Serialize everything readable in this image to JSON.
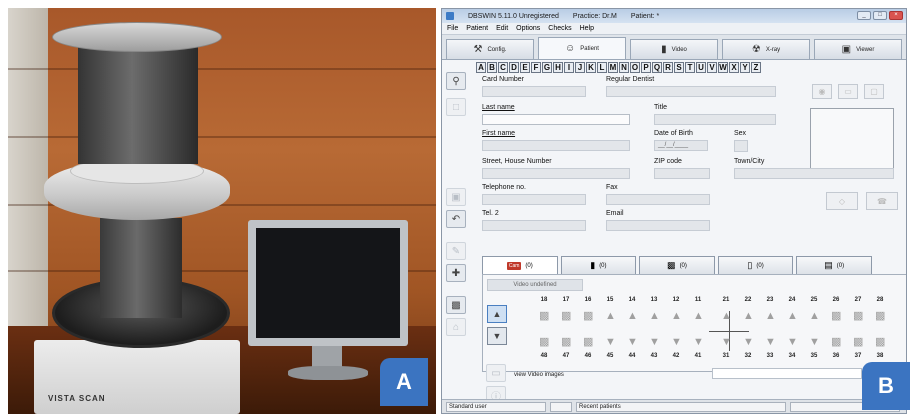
{
  "panel_a": {
    "scanner_brand": "VISTA SCAN",
    "badge": "A"
  },
  "panel_b": {
    "badge": "B",
    "window": {
      "app_title": "DBSWIN 5.11.0 Unregistered",
      "practice": "Practice: Dr.M",
      "patient": "Patient: *",
      "controls": [
        "_",
        "□",
        "×"
      ]
    },
    "menu": [
      "File",
      "Patient",
      "Edit",
      "Options",
      "Checks",
      "Help"
    ],
    "tabs": [
      {
        "label": "Config.",
        "icon": "wrench-icon",
        "glyph": "⚒"
      },
      {
        "label": "Patient",
        "icon": "patient-icon",
        "glyph": "☺"
      },
      {
        "label": "Video",
        "icon": "video-camera-icon",
        "glyph": "▮"
      },
      {
        "label": "X-ray",
        "icon": "radiation-icon",
        "glyph": "☢"
      },
      {
        "label": "Viewer",
        "icon": "viewer-icon",
        "glyph": "▣"
      }
    ],
    "alphabet": [
      "A",
      "B",
      "C",
      "D",
      "E",
      "F",
      "G",
      "H",
      "I",
      "J",
      "K",
      "L",
      "M",
      "N",
      "O",
      "P",
      "Q",
      "R",
      "S",
      "T",
      "U",
      "V",
      "W",
      "X",
      "Y",
      "Z"
    ],
    "form": {
      "card_number": "Card Number",
      "regular_dentist": "Regular Dentist",
      "last_name": "Last name",
      "title": "Title",
      "first_name": "First name",
      "date_of_birth": "Date of Birth",
      "date_placeholder": "__/__/____",
      "sex": "Sex",
      "street": "Street, House Number",
      "zip": "ZIP code",
      "town": "Town/City",
      "telephone": "Telephone no.",
      "fax": "Fax",
      "tel2": "Tel. 2",
      "email": "Email"
    },
    "media_tabs": [
      {
        "badge": "Cam",
        "count": "(0)"
      },
      {
        "count": "(0)"
      },
      {
        "count": "(0)"
      },
      {
        "count": "(0)"
      },
      {
        "count": "(0)"
      }
    ],
    "video_undefined": "Video undefined",
    "upper_teeth": [
      "18",
      "17",
      "16",
      "15",
      "14",
      "13",
      "12",
      "11",
      "21",
      "22",
      "23",
      "24",
      "25",
      "26",
      "27",
      "28"
    ],
    "lower_teeth": [
      "48",
      "47",
      "46",
      "45",
      "44",
      "43",
      "42",
      "41",
      "31",
      "32",
      "33",
      "34",
      "35",
      "36",
      "37",
      "38"
    ],
    "view_video_images": "view Video images",
    "status": [
      "Standard user",
      "",
      "Recent patients",
      ""
    ]
  }
}
